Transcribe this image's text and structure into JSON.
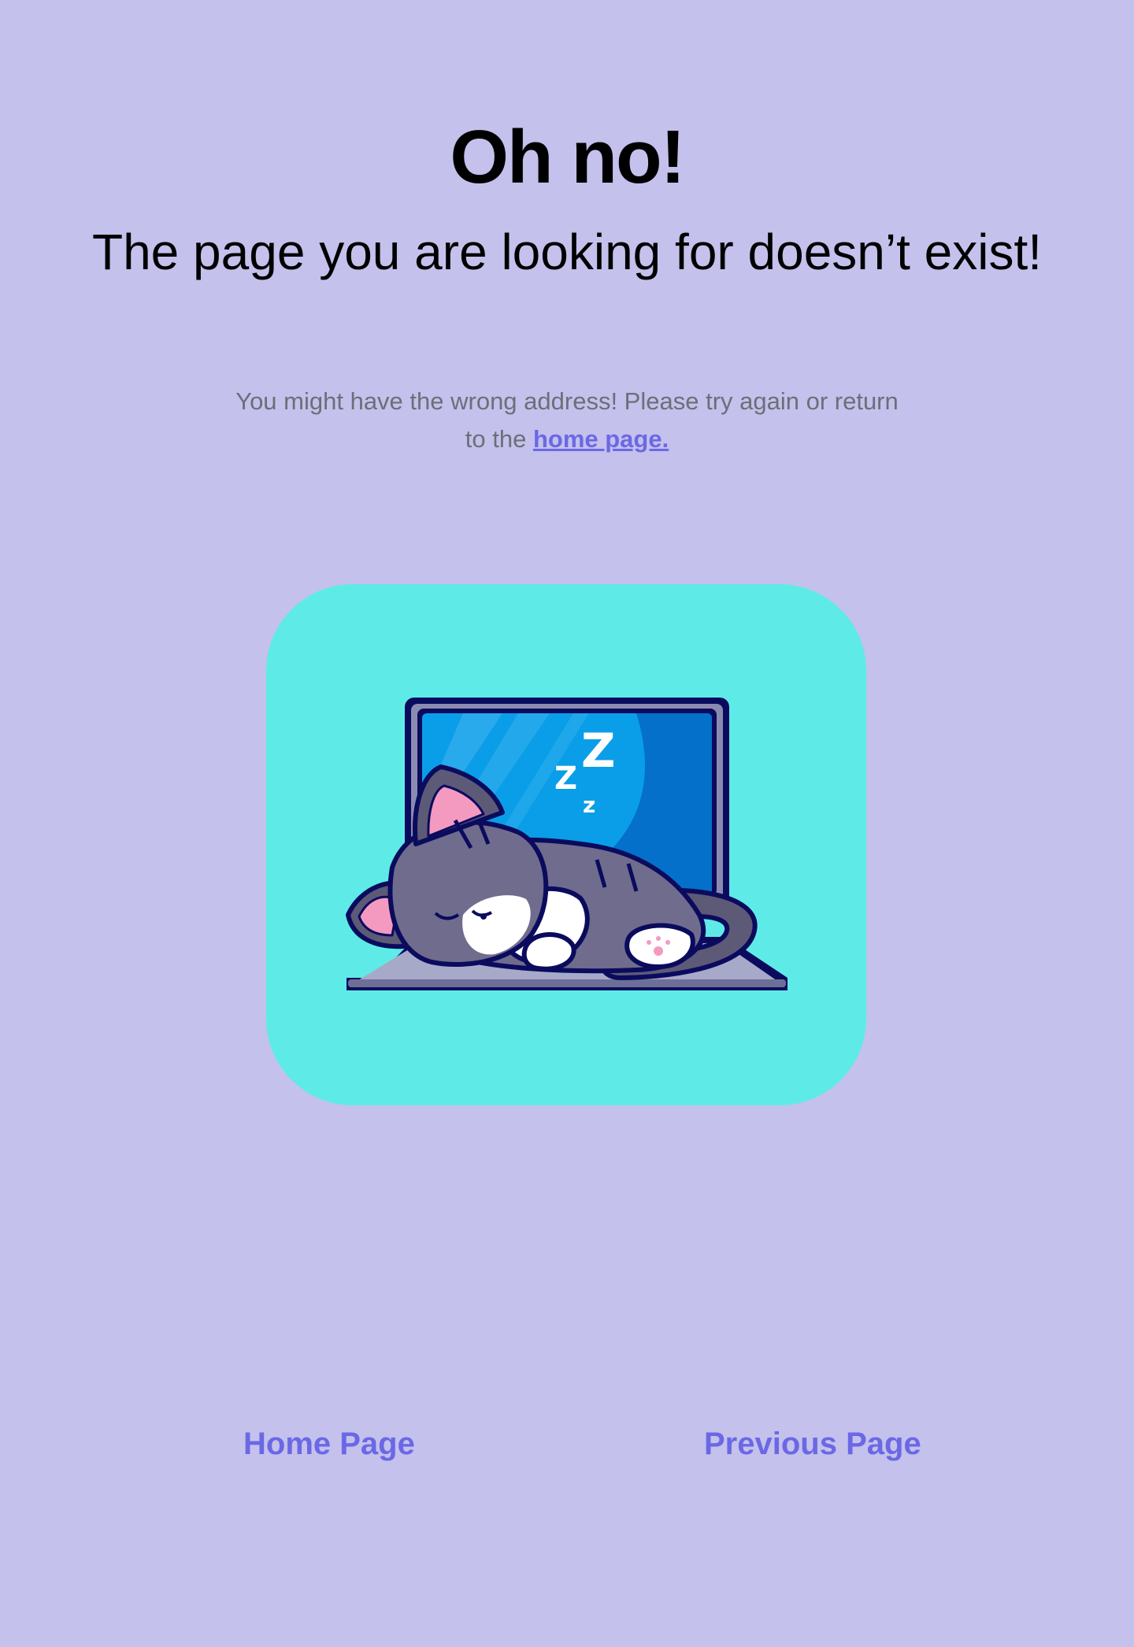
{
  "heading": {
    "title": "Oh no!",
    "subtitle": "The page you are looking for doesn’t exist!"
  },
  "message": {
    "text": "You might have the wrong address! Please try again or return to the ",
    "link_label": "home page."
  },
  "illustration": {
    "sleep_letters": [
      "Z",
      "Z",
      "z"
    ]
  },
  "nav": {
    "home_label": "Home Page",
    "previous_label": "Previous Page"
  },
  "colors": {
    "background": "#c4c1ec",
    "accent": "#6b68e6",
    "card": "#5eebe8"
  }
}
